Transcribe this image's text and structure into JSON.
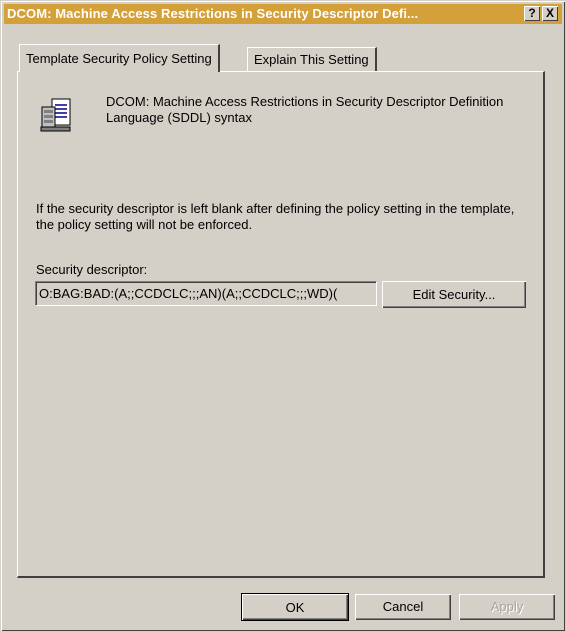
{
  "window": {
    "title": "DCOM: Machine Access Restrictions in Security Descriptor Defi...",
    "help_button": "?",
    "close_button": "X"
  },
  "tabs": [
    {
      "label": "Template Security Policy Setting",
      "active": true
    },
    {
      "label": "Explain This Setting",
      "active": false
    }
  ],
  "policy": {
    "icon": "policy-scroll-icon",
    "name": "DCOM: Machine Access Restrictions in Security Descriptor Definition Language (SDDL) syntax",
    "note": "If the security descriptor is left blank after defining the policy setting in the template, the policy setting will not be enforced.",
    "descriptor_label": "Security descriptor:",
    "descriptor_value": "O:BAG:BAD:(A;;CCDCLC;;;AN)(A;;CCDCLC;;;WD)(",
    "edit_button": "Edit Security..."
  },
  "footer": {
    "ok": "OK",
    "cancel": "Cancel",
    "apply": "Apply"
  },
  "colors": {
    "titlebar": "#d4a03a",
    "face": "#d4d0c8"
  }
}
